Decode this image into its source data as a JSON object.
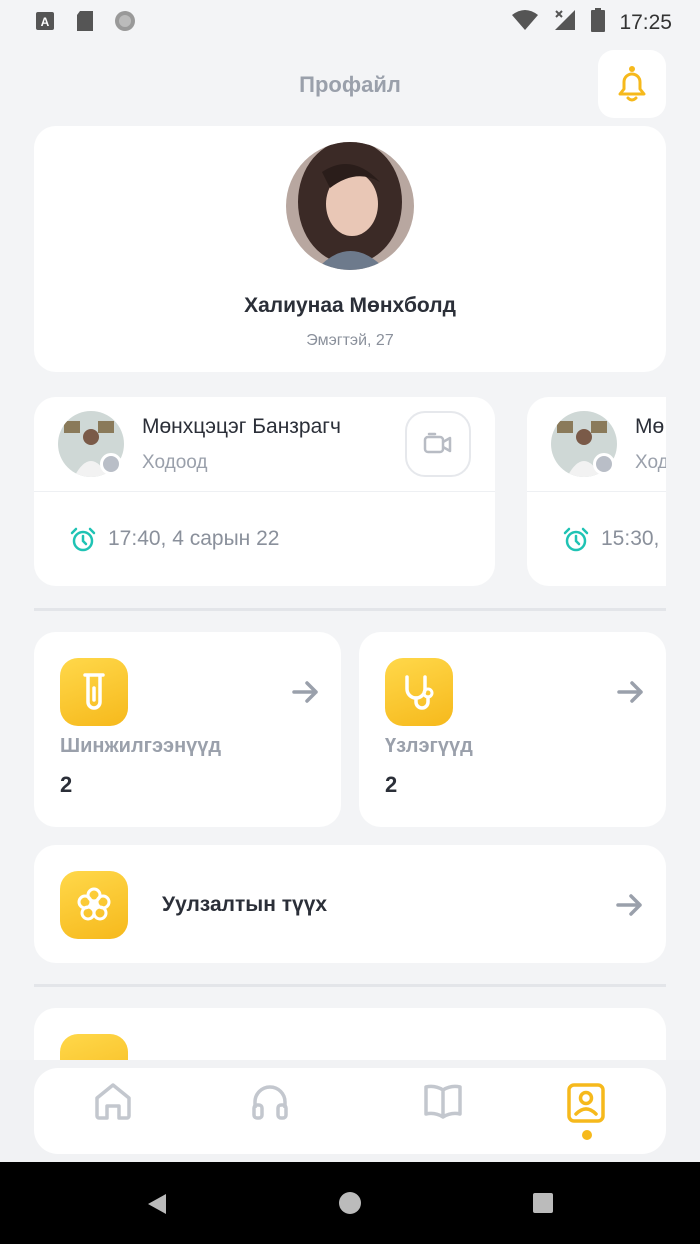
{
  "status_bar": {
    "time": "17:25",
    "keyboard_badge": "A"
  },
  "header": {
    "title": "Профайл"
  },
  "profile": {
    "name": "Халиунаа Мөнхболд",
    "subtitle": "Эмэгтэй, 27"
  },
  "appointments": [
    {
      "doctor": "Мөнхцэцэг Банзрагч",
      "status": "Ходоод",
      "time": "17:40, 4 сарын 22"
    },
    {
      "doctor": "Мө",
      "status": "Ход",
      "time": "15:30,"
    }
  ],
  "stats": [
    {
      "label": "Шинжилгээнүүд",
      "value": "2",
      "icon": "test-tube-icon"
    },
    {
      "label": "Үзлэгүүд",
      "value": "2",
      "icon": "stethoscope-icon"
    }
  ],
  "history": {
    "label": "Уулзалтын түүх",
    "icon": "flower-icon"
  },
  "nav": [
    "home-icon",
    "headphones-icon",
    "book-icon",
    "profile-icon"
  ],
  "colors": {
    "accent": "#f6b91c",
    "teal": "#1fc3b4",
    "muted": "#9aa0ab",
    "text": "#2b2f38",
    "background": "#f3f4f6"
  }
}
